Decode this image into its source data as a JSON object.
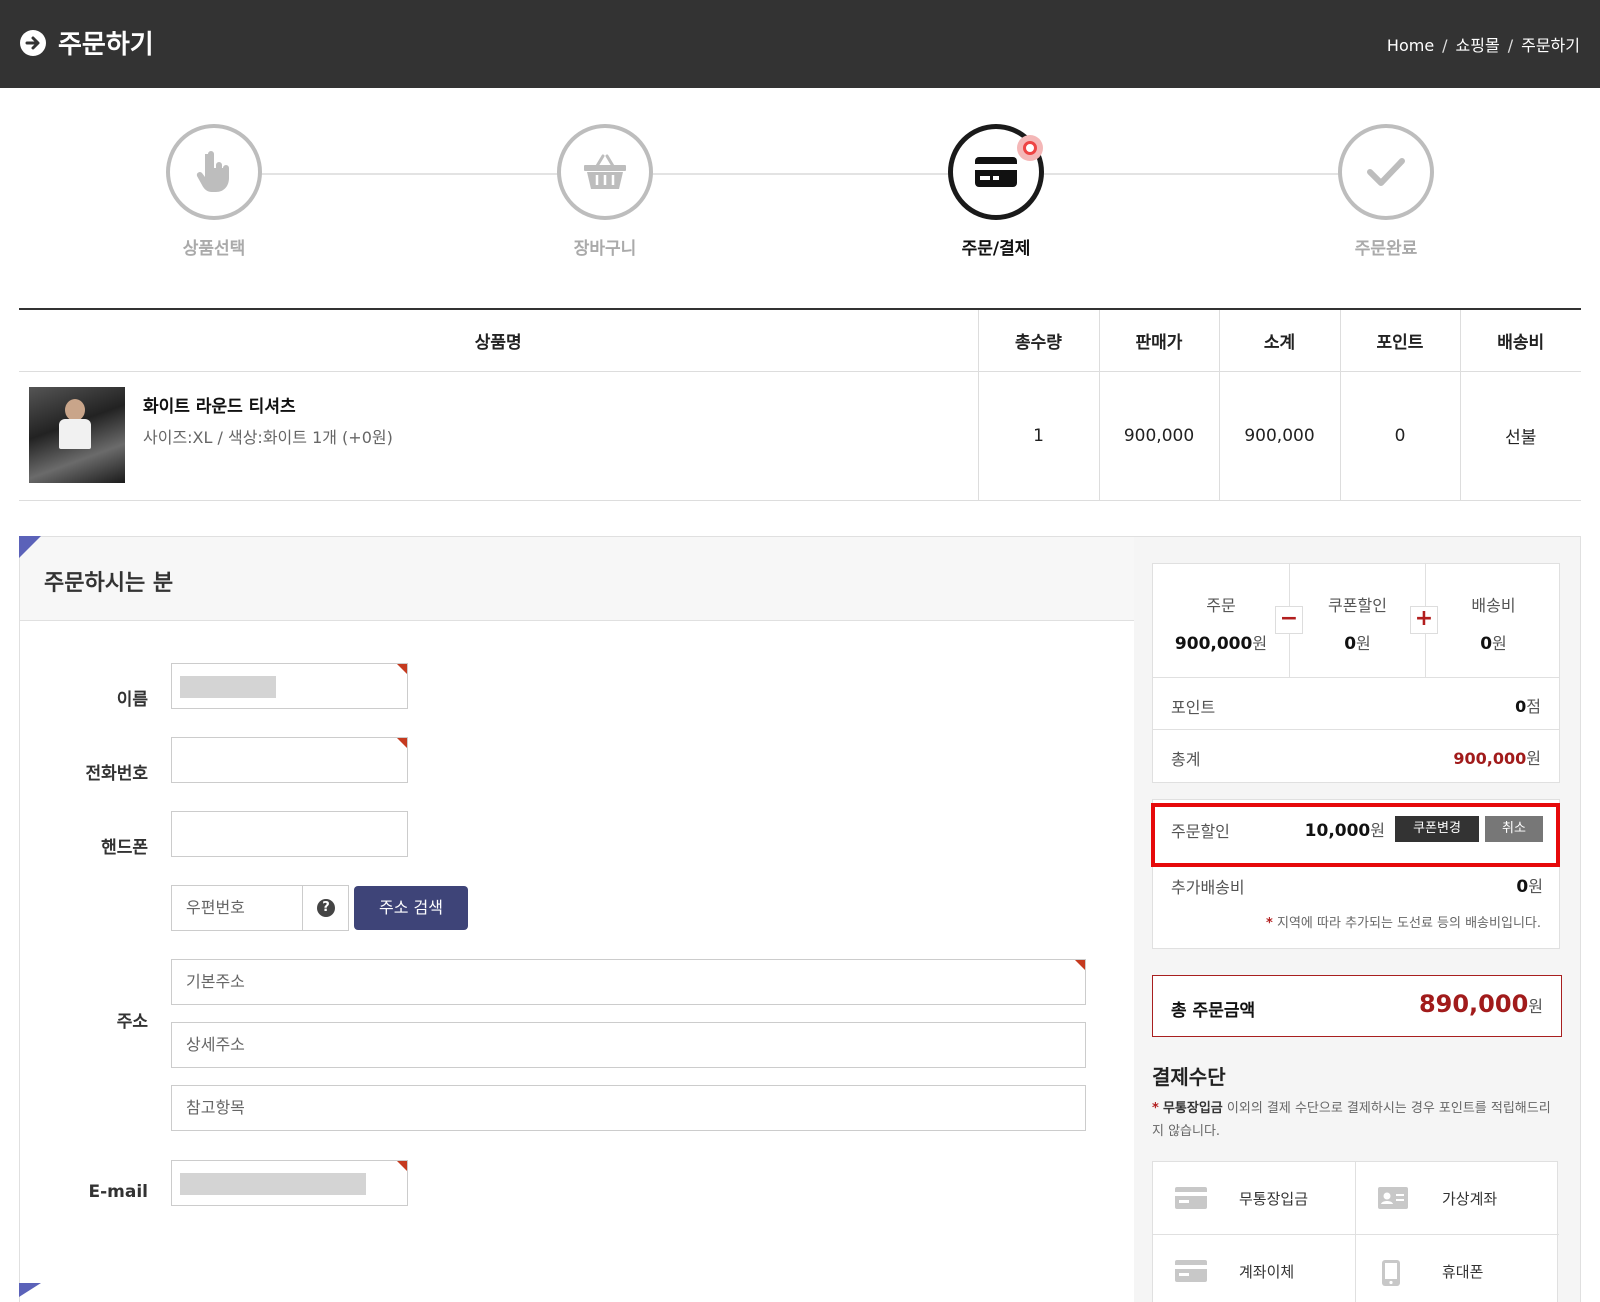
{
  "header": {
    "title": "주문하기",
    "breadcrumb": [
      "Home",
      "쇼핑몰",
      "주문하기"
    ]
  },
  "steps": [
    {
      "label": "상품선택",
      "icon": "hand-pointer-icon",
      "active": false
    },
    {
      "label": "장바구니",
      "icon": "basket-icon",
      "active": false
    },
    {
      "label": "주문/결제",
      "icon": "credit-card-icon",
      "active": true
    },
    {
      "label": "주문완료",
      "icon": "checkmark-icon",
      "active": false
    }
  ],
  "table": {
    "headers": [
      "상품명",
      "총수량",
      "판매가",
      "소계",
      "포인트",
      "배송비"
    ],
    "rows": [
      {
        "name": "화이트 라운드 티셔츠",
        "option": "사이즈:XL / 색상:화이트 1개 (+0원)",
        "qty": "1",
        "price": "900,000",
        "subtotal": "900,000",
        "point": "0",
        "shipping": "선불"
      }
    ]
  },
  "orderer": {
    "section_title": "주문하시는 분",
    "labels": {
      "name": "이름",
      "phone": "전화번호",
      "mobile": "핸드폰",
      "address": "주소",
      "email": "E-mail"
    },
    "placeholders": {
      "zipcode": "우편번호",
      "address1": "기본주소",
      "address2": "상세주소",
      "address3": "참고항목"
    },
    "zip_help": "?",
    "search_btn": "주소 검색"
  },
  "summary": {
    "order_label": "주문",
    "order_value": "900,000",
    "coupon_label": "쿠폰할인",
    "coupon_value": "0",
    "ship_label": "배송비",
    "ship_value": "0",
    "unit_won": "원",
    "minus": "−",
    "plus": "+",
    "point_label": "포인트",
    "point_value": "0",
    "unit_point": "점",
    "total_label": "총계",
    "total_value": "900,000"
  },
  "discount": {
    "label": "주문할인",
    "value": "10,000",
    "unit": "원",
    "change_btn": "쿠폰변경",
    "cancel_btn": "취소",
    "extra_label": "추가배송비",
    "extra_value": "0",
    "note_star": "*",
    "note": "지역에 따라 추가되는 도선료 등의 배송비입니다."
  },
  "grand_total": {
    "label": "총 주문금액",
    "value": "890,000",
    "unit": "원"
  },
  "payment": {
    "title": "결제수단",
    "note_star": "*",
    "note_bold": "무통장입금",
    "note_text": " 이외의 결제 수단으로 결제하시는 경우 포인트를 적립해드리지 않습니다.",
    "methods": [
      {
        "label": "무통장입금",
        "icon": "bank-card-icon"
      },
      {
        "label": "가상계좌",
        "icon": "id-card-icon"
      },
      {
        "label": "계좌이체",
        "icon": "transfer-card-icon"
      },
      {
        "label": "휴대폰",
        "icon": "mobile-phone-icon"
      }
    ]
  },
  "colors": {
    "header_bg": "#333333",
    "accent_red": "#a11b1b",
    "button_navy": "#3e4478",
    "highlight": "#e6090a",
    "corner": "#5b62b9"
  }
}
